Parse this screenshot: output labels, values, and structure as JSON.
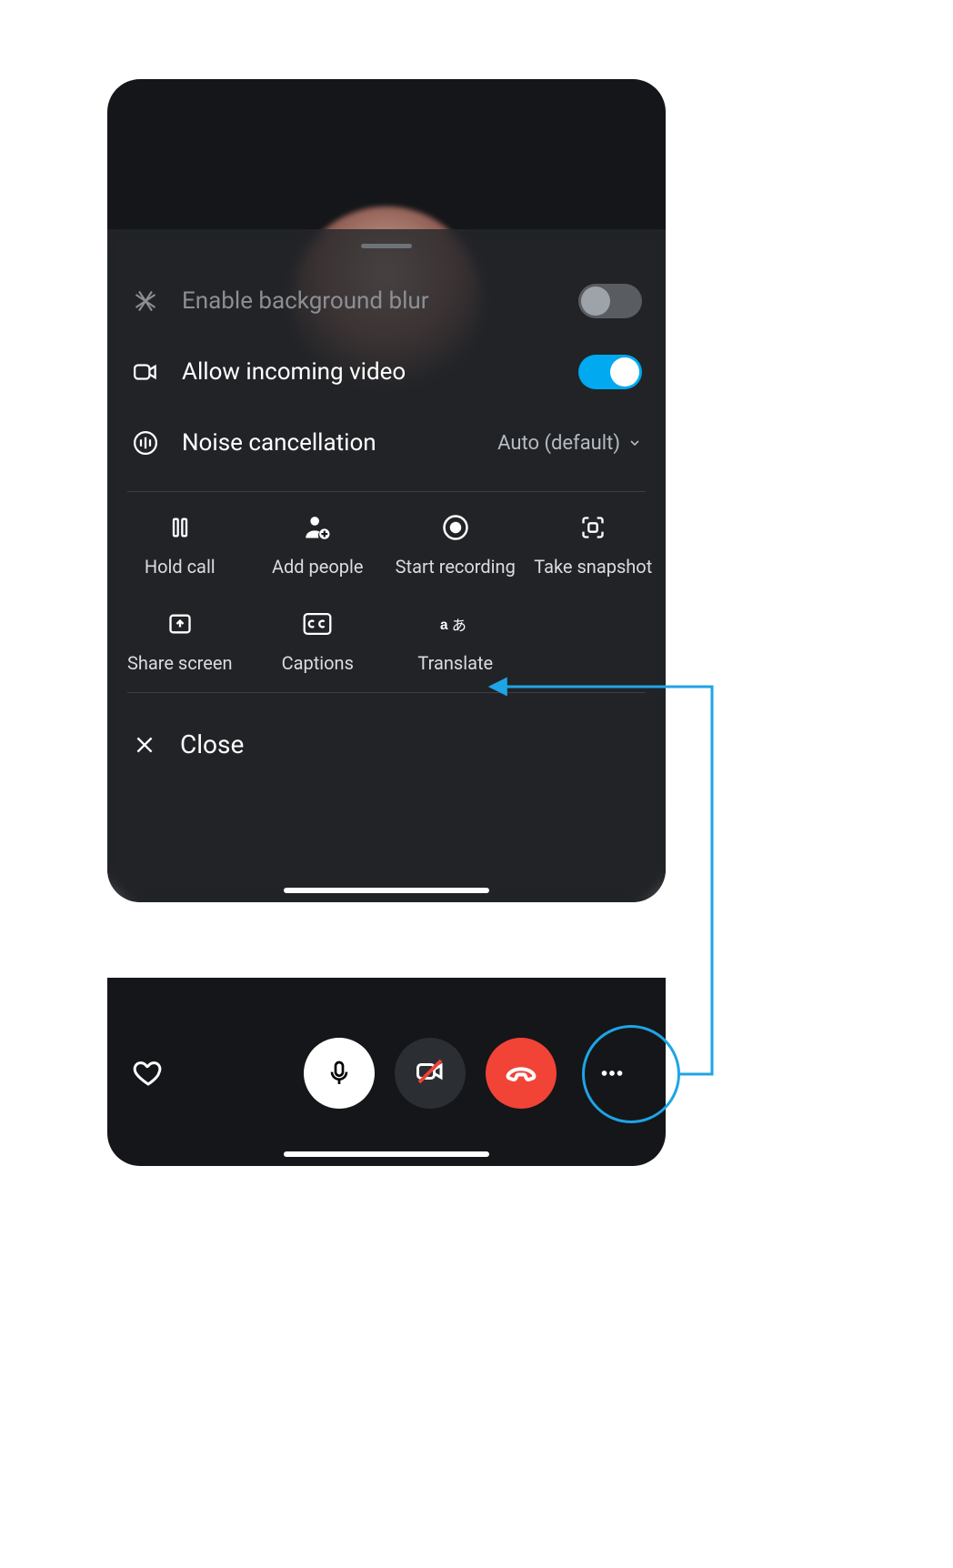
{
  "sheet": {
    "rows": {
      "blur": {
        "label": "Enable background blur",
        "enabled": false
      },
      "video": {
        "label": "Allow incoming video",
        "enabled": true
      },
      "noise": {
        "label": "Noise cancellation",
        "value": "Auto (default)"
      }
    },
    "actions": {
      "hold": {
        "label": "Hold call"
      },
      "add": {
        "label": "Add people"
      },
      "record": {
        "label": "Start recording"
      },
      "snapshot": {
        "label": "Take snapshot"
      },
      "share": {
        "label": "Share screen"
      },
      "captions": {
        "label": "Captions"
      },
      "translate": {
        "label": "Translate"
      }
    },
    "close_label": "Close"
  },
  "annotation": {
    "color": "#1fa4e6"
  }
}
